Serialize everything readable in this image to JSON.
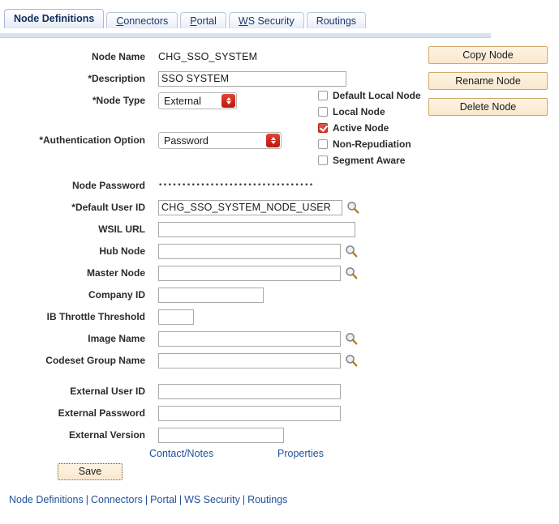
{
  "tabs": [
    {
      "label": "Node Definitions",
      "accel": "",
      "active": true
    },
    {
      "label": "Connectors",
      "accel": "C",
      "active": false
    },
    {
      "label": "Portal",
      "accel": "P",
      "active": false
    },
    {
      "label": "WS Security",
      "accel": "W",
      "active": false
    },
    {
      "label": "Routings",
      "accel": "",
      "active": false
    }
  ],
  "form": {
    "node_name_label": "Node Name",
    "node_name_value": "CHG_SSO_SYSTEM",
    "description_label": "*Description",
    "description_value": "SSO SYSTEM",
    "node_type_label": "*Node Type",
    "node_type_value": "External",
    "node_type_options": [
      "External"
    ],
    "auth_option_label": "*Authentication Option",
    "auth_option_value": "Password",
    "auth_option_options": [
      "Password"
    ],
    "node_password_label": "Node Password",
    "node_password_value": "•••••••••••••••••••••••••••••••••",
    "default_user_id_label": "*Default User ID",
    "default_user_id_value": "CHG_SSO_SYSTEM_NODE_USER",
    "wsil_url_label": "WSIL URL",
    "wsil_url_value": "",
    "hub_node_label": "Hub Node",
    "hub_node_value": "",
    "master_node_label": "Master Node",
    "master_node_value": "",
    "company_id_label": "Company ID",
    "company_id_value": "",
    "ib_throttle_label": "IB Throttle Threshold",
    "ib_throttle_value": "",
    "image_name_label": "Image Name",
    "image_name_value": "",
    "codeset_group_label": "Codeset Group Name",
    "codeset_group_value": "",
    "external_user_id_label": "External User ID",
    "external_user_id_value": "",
    "external_password_label": "External Password",
    "external_password_value": "",
    "external_version_label": "External Version",
    "external_version_value": ""
  },
  "checkboxes": [
    {
      "label": "Default Local Node",
      "checked": false
    },
    {
      "label": "Local Node",
      "checked": false
    },
    {
      "label": "Active Node",
      "checked": true
    },
    {
      "label": "Non-Repudiation",
      "checked": false
    },
    {
      "label": "Segment Aware",
      "checked": false
    }
  ],
  "actions": [
    {
      "label": "Copy Node"
    },
    {
      "label": "Rename Node"
    },
    {
      "label": "Delete Node"
    }
  ],
  "links": {
    "contact_notes": "Contact/Notes",
    "properties": "Properties"
  },
  "save_label": "Save",
  "footer_links": [
    "Node Definitions",
    "Connectors",
    "Portal",
    "WS Security",
    "Routings"
  ],
  "footer_separator": "|",
  "colors": {
    "tab_active_text": "#13305c",
    "tab_text": "#1a3a6b",
    "tab_underline": "#d9e2f2",
    "button_face": "#fae8cd",
    "button_border": "#d2a86a",
    "checkbox_checked": "#d23a2a",
    "select_button": "#cf2a1c",
    "link": "#21519e",
    "field_border": "#a9a9a9",
    "label_text": "#2b2b2b",
    "page_background": "#ffffff"
  }
}
